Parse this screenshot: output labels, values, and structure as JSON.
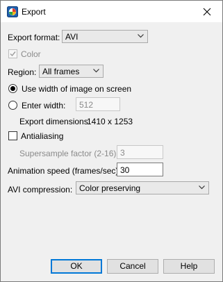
{
  "window": {
    "title": "Export"
  },
  "export_format": {
    "label": "Export format:",
    "value": "AVI"
  },
  "color": {
    "label": "Color",
    "checked": true,
    "enabled": false
  },
  "region": {
    "label": "Region:",
    "value": "All frames"
  },
  "width_options": {
    "use_screen_width": {
      "label": "Use width of image on screen",
      "selected": true
    },
    "enter_width": {
      "label": "Enter width:",
      "selected": false,
      "value": "512"
    }
  },
  "dimensions": {
    "label": "Export dimensions:",
    "value": "1410 x 1253"
  },
  "antialiasing": {
    "label": "Antialiasing",
    "checked": false
  },
  "supersample": {
    "label": "Supersample factor (2-16):",
    "value": "3"
  },
  "animation_speed": {
    "label": "Animation speed (frames/sec):",
    "value": "30"
  },
  "avi_compression": {
    "label": "AVI compression:",
    "value": "Color preserving"
  },
  "buttons": {
    "ok": "OK",
    "cancel": "Cancel",
    "help": "Help"
  },
  "colors": {
    "default_button_border": "#0078d7",
    "dialog_bg": "#f0f0f0"
  }
}
